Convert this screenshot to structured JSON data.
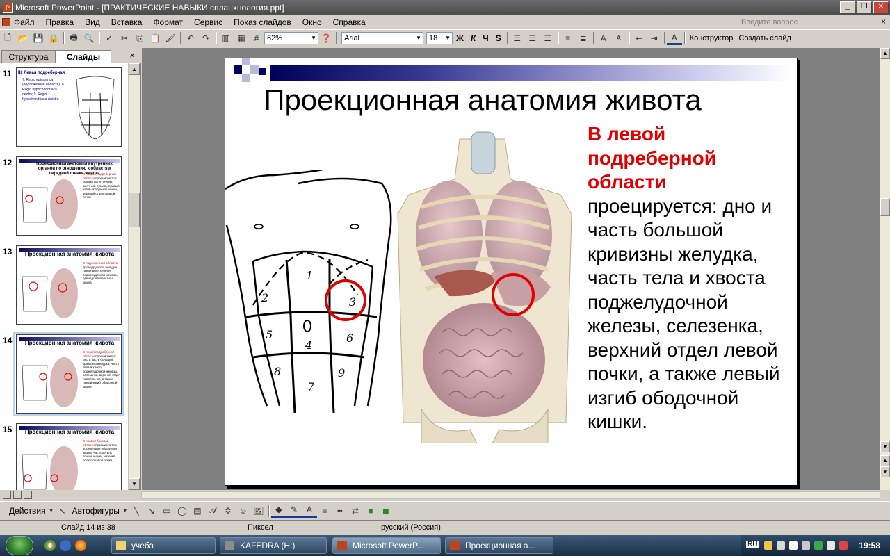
{
  "window": {
    "title": "Microsoft PowerPoint - [ПРАКТИЧЕСКИЕ НАВЫКИ спланхнология.ppt]"
  },
  "menu": {
    "items": [
      "Файл",
      "Правка",
      "Вид",
      "Вставка",
      "Формат",
      "Сервис",
      "Показ слайдов",
      "Окно",
      "Справка"
    ],
    "help_placeholder": "Введите вопрос"
  },
  "toolbar": {
    "zoom": "62%",
    "font_name": "Arial",
    "font_size": "18",
    "bold": "Ж",
    "italic": "К",
    "underline": "Ч",
    "shadow": "S",
    "designer_label": "Конструктор",
    "new_slide_label": "Создать слайд"
  },
  "left_pane": {
    "tab_structure": "Структура",
    "tab_slides": "Слайды",
    "close": "×",
    "thumbnails": [
      {
        "number": "11",
        "title": "III. Левая подреберная",
        "body_red": "",
        "body": "7. Regio epigastrica (подложечная область); 8. Regio hypochondriaca dextra; 9. Regio hypochondriaca sinistra"
      },
      {
        "number": "12",
        "title": "Проекционная анатомия внутренних органов по отношению к областям передней стенки живота",
        "body_red": "В правой подреберной области",
        "body": "проецируются: правая доля печени, желчный пузырь, правый изгиб ободочной кишки, верхний отдел правой почки"
      },
      {
        "number": "13",
        "title": "Проекционная анатомия живота",
        "body_red": "В подложечной области",
        "body": "проецируются: желудок, левая доля печени, поджелудочная железа, двенадцатиперстная кишка"
      },
      {
        "number": "14",
        "title": "Проекционная анатомия живота",
        "body_red": "В левой подреберной области",
        "body": "проецируется: дно и часть большой кривизны желудка, часть тела и хвоста поджелудочной железы, селезенка, верхний отдел левой почки, а также левый изгиб ободочной кишки."
      },
      {
        "number": "15",
        "title": "Проекционная анатомия живота",
        "body_red": "В правой боковой области",
        "body": "проецируются: восходящая ободочная кишка, часть петель тонкой кишки, нижний полюс правой почки"
      }
    ]
  },
  "slide": {
    "title": "Проекционная анатомия живота",
    "body_red": "В левой подреберной области",
    "body": "проецируется: дно и часть большой кривизны желудка, часть тела и хвоста поджелудочной железы, селезенка, верхний отдел левой почки, а также левый изгиб ободочной кишки.",
    "region_numbers": [
      "1",
      "2",
      "3",
      "4",
      "5",
      "6",
      "7",
      "8",
      "9"
    ],
    "accent_color": "#e00000",
    "bar_color": "#00005a"
  },
  "drawing_toolbar": {
    "actions_label": "Действия",
    "autoshapes_label": "Автофигуры"
  },
  "statusbar": {
    "slide_position": "Слайд 14 из 38",
    "design": "Пиксел",
    "language": "русский (Россия)"
  },
  "taskbar": {
    "tasks": [
      "учеба",
      "KAFEDRA (H:)",
      "Microsoft PowerP...",
      "Проекционная а..."
    ],
    "language": "RU",
    "clock": "19:58"
  }
}
